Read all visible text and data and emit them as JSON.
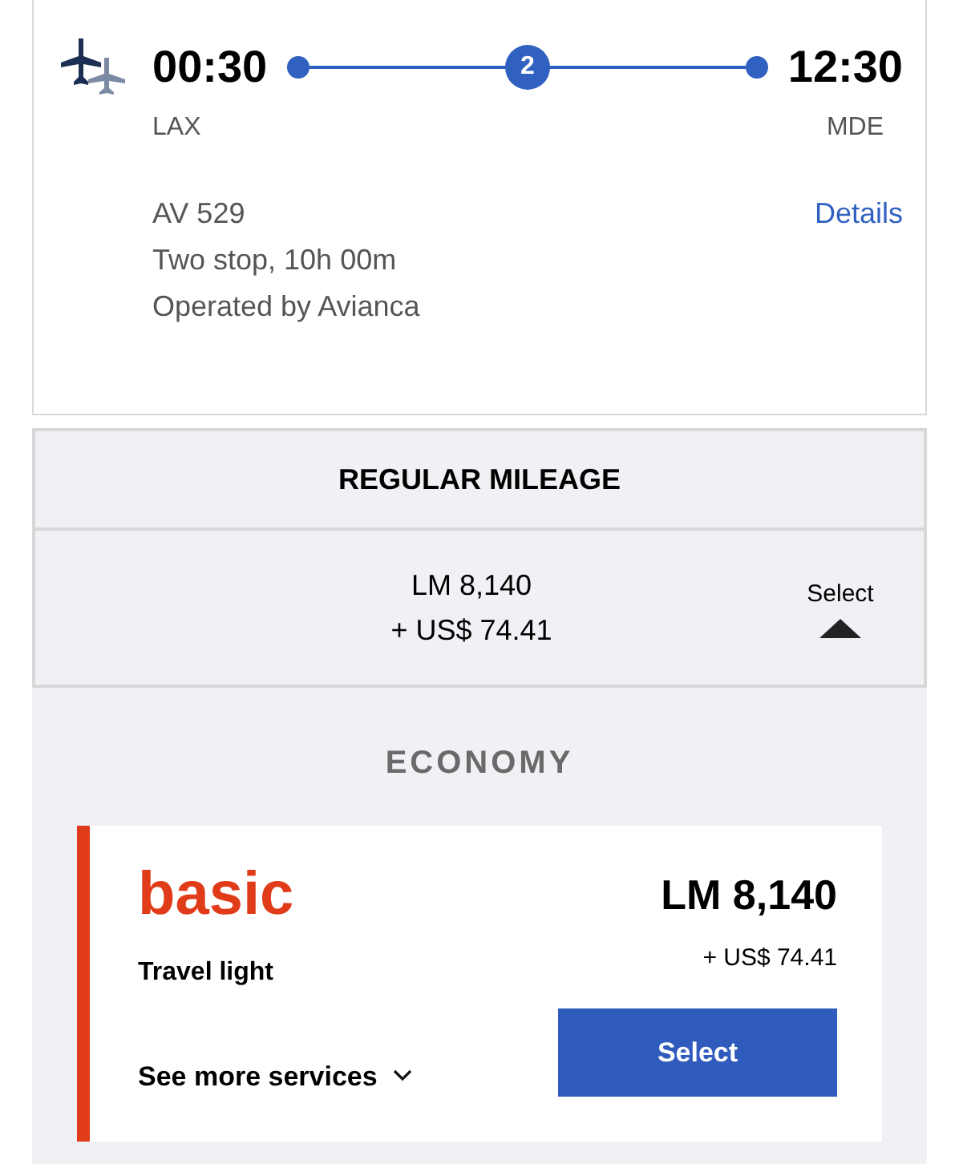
{
  "flight": {
    "departure_time": "00:30",
    "departure_airport": "LAX",
    "stops": "2",
    "arrival_time": "12:30",
    "arrival_airport": "MDE",
    "flight_number": "AV 529",
    "duration": "Two stop, 10h 00m",
    "operator": "Operated by Avianca",
    "details_link": "Details"
  },
  "mileage": {
    "title": "REGULAR MILEAGE",
    "miles": "LM 8,140",
    "cash": "+ US$ 74.41",
    "select_label": "Select",
    "expanded": true
  },
  "cabin": {
    "title": "ECONOMY",
    "fare": {
      "name": "basic",
      "color": "#e03c1a",
      "description": "Travel light",
      "miles": "LM 8,140",
      "cash": "+ US$ 74.41",
      "more_link": "See more services",
      "select_button": "Select"
    }
  }
}
